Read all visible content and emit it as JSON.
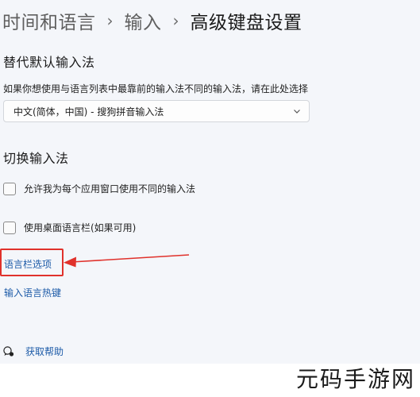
{
  "breadcrumb": {
    "items": [
      "时间和语言",
      "输入",
      "高级键盘设置"
    ],
    "separator": "›"
  },
  "override_section": {
    "title": "替代默认输入法",
    "description": "如果你想使用与语言列表中最靠前的输入法不同的输入法，请在此处选择",
    "dropdown_value": "中文(简体，中国) - 搜狗拼音输入法"
  },
  "switch_section": {
    "title": "切换输入法",
    "checkboxes": [
      {
        "label": "允许我为每个应用窗口使用不同的输入法",
        "checked": false
      },
      {
        "label": "使用桌面语言栏(如果可用)",
        "checked": false
      }
    ]
  },
  "links": {
    "language_bar_options": "语言栏选项",
    "input_language_hotkeys": "输入语言热键"
  },
  "help": {
    "label": "获取帮助",
    "icon": "help-chat-icon"
  },
  "annotation": {
    "color": "#e0312b"
  },
  "watermark": "元码手游网",
  "colors": {
    "link": "#1d5ba8",
    "background": "#f4f6fa"
  }
}
